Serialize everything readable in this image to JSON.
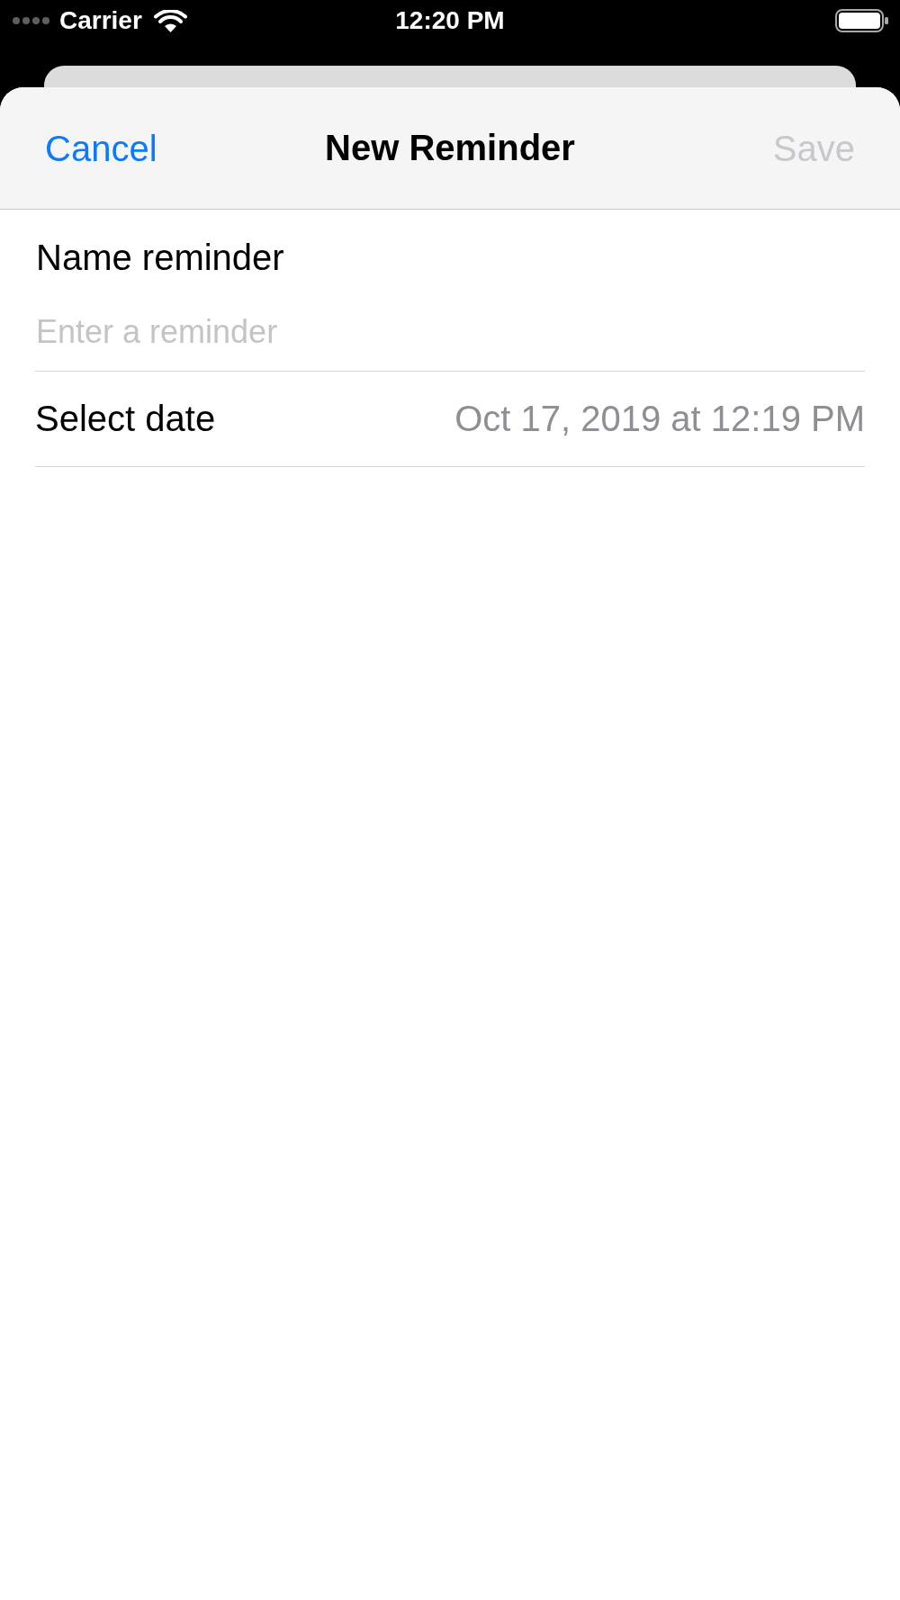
{
  "status_bar": {
    "carrier": "Carrier",
    "time": "12:20 PM"
  },
  "navigation_bar": {
    "cancel_button": {
      "label": "Cancel",
      "disabled": false
    },
    "title": "New Reminder",
    "save_button": {
      "label": "Save",
      "disabled": true
    }
  },
  "form": {
    "name_label": "Name reminder",
    "name_field": {
      "placeholder": "Enter a reminder"
    },
    "date_row": {
      "label": "Select date",
      "value": "Oct 17, 2019 at 12:19 PM"
    }
  }
}
